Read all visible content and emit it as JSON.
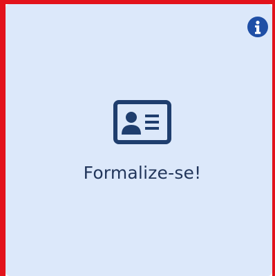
{
  "card": {
    "title": "Formalize-se!",
    "icon": "id-card-icon",
    "info_icon": "info-icon"
  },
  "colors": {
    "frame_border": "#e3121b",
    "card_background": "#dce8fa",
    "icon_color": "#1f3e6e",
    "info_background": "#1f4fa6",
    "title_color": "#22365b"
  }
}
